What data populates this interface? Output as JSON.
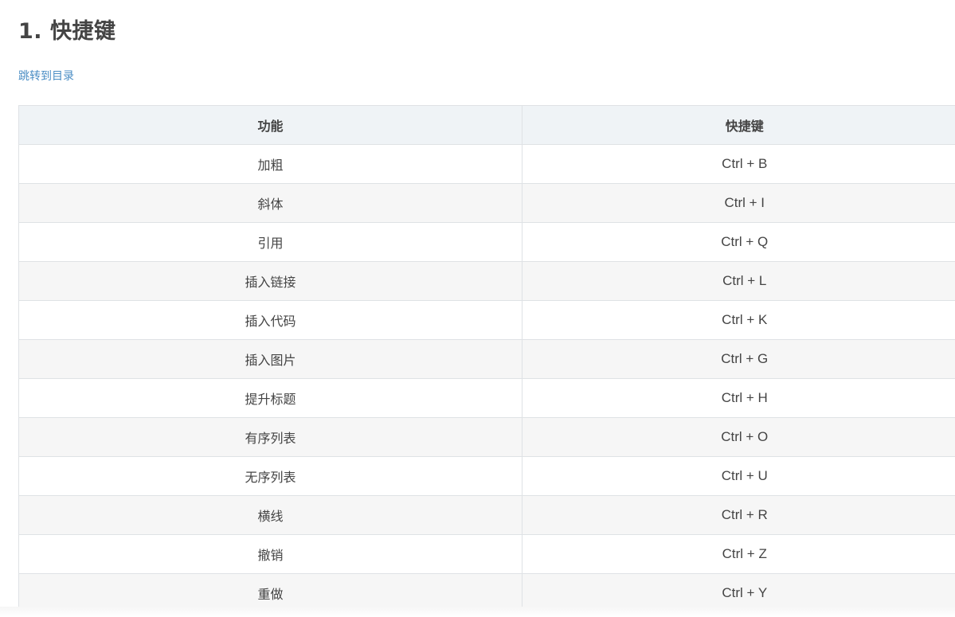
{
  "heading": "1. 快捷键",
  "toc_link": "跳转到目录",
  "table": {
    "headers": [
      "功能",
      "快捷键"
    ],
    "rows": [
      {
        "function": "加粗",
        "shortcut": "Ctrl + B"
      },
      {
        "function": "斜体",
        "shortcut": "Ctrl + I"
      },
      {
        "function": "引用",
        "shortcut": "Ctrl + Q"
      },
      {
        "function": "插入链接",
        "shortcut": "Ctrl + L"
      },
      {
        "function": "插入代码",
        "shortcut": "Ctrl + K"
      },
      {
        "function": "插入图片",
        "shortcut": "Ctrl + G"
      },
      {
        "function": "提升标题",
        "shortcut": "Ctrl + H"
      },
      {
        "function": "有序列表",
        "shortcut": "Ctrl + O"
      },
      {
        "function": "无序列表",
        "shortcut": "Ctrl + U"
      },
      {
        "function": "横线",
        "shortcut": "Ctrl + R"
      },
      {
        "function": "撤销",
        "shortcut": "Ctrl + Z"
      },
      {
        "function": "重做",
        "shortcut": "Ctrl + Y"
      }
    ]
  },
  "colors": {
    "heading": "#444444",
    "link": "#4a8dc4",
    "header_bg": "#eff3f6",
    "stripe_bg": "#f6f6f6",
    "border": "#dfe2e5"
  }
}
